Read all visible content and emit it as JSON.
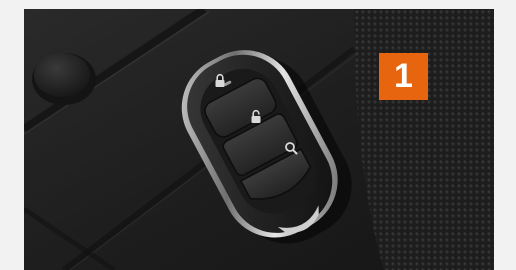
{
  "image": {
    "subject": "car-key-fob",
    "buttons": [
      "lock-icon",
      "unlock-icon",
      "search-icon"
    ]
  },
  "badge": {
    "label": "1",
    "color": "#e8650f"
  }
}
